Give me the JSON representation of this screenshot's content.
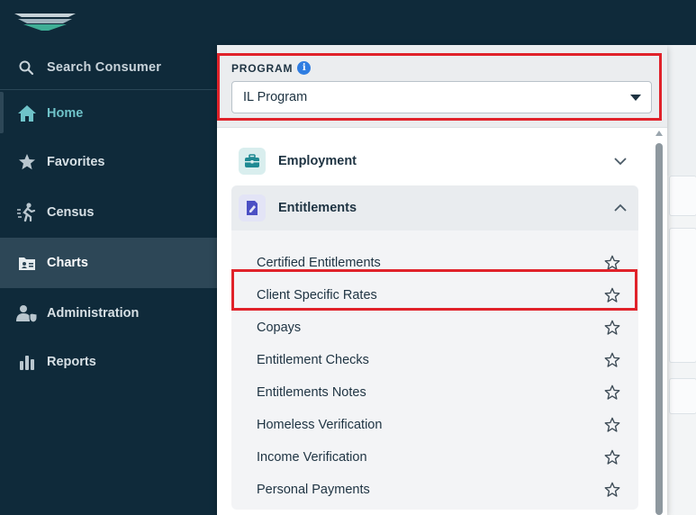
{
  "sidebar": {
    "search_label": "Search Consumer",
    "items": [
      {
        "label": "Home",
        "icon": "home-icon"
      },
      {
        "label": "Favorites",
        "icon": "star-icon"
      },
      {
        "label": "Census",
        "icon": "census-icon"
      },
      {
        "label": "Charts",
        "icon": "charts-icon"
      },
      {
        "label": "Administration",
        "icon": "admin-icon"
      },
      {
        "label": "Reports",
        "icon": "reports-icon"
      }
    ]
  },
  "program": {
    "label": "PROGRAM",
    "selected": "IL Program"
  },
  "sections": [
    {
      "label": "Employment",
      "icon": "briefcase-icon",
      "expanded": false
    },
    {
      "label": "Entitlements",
      "icon": "document-icon",
      "expanded": true
    }
  ],
  "entitlements_items": [
    "Certified Entitlements",
    "Client Specific Rates",
    "Copays",
    "Entitlement Checks",
    "Entitlements Notes",
    "Homeless Verification",
    "Income Verification",
    "Personal Payments"
  ],
  "colors": {
    "navy": "#0f2a3a",
    "active_nav": "#2d4757",
    "home_accent": "#6fc3c9",
    "highlight": "#e0222a",
    "info_blue": "#2f7de1"
  }
}
